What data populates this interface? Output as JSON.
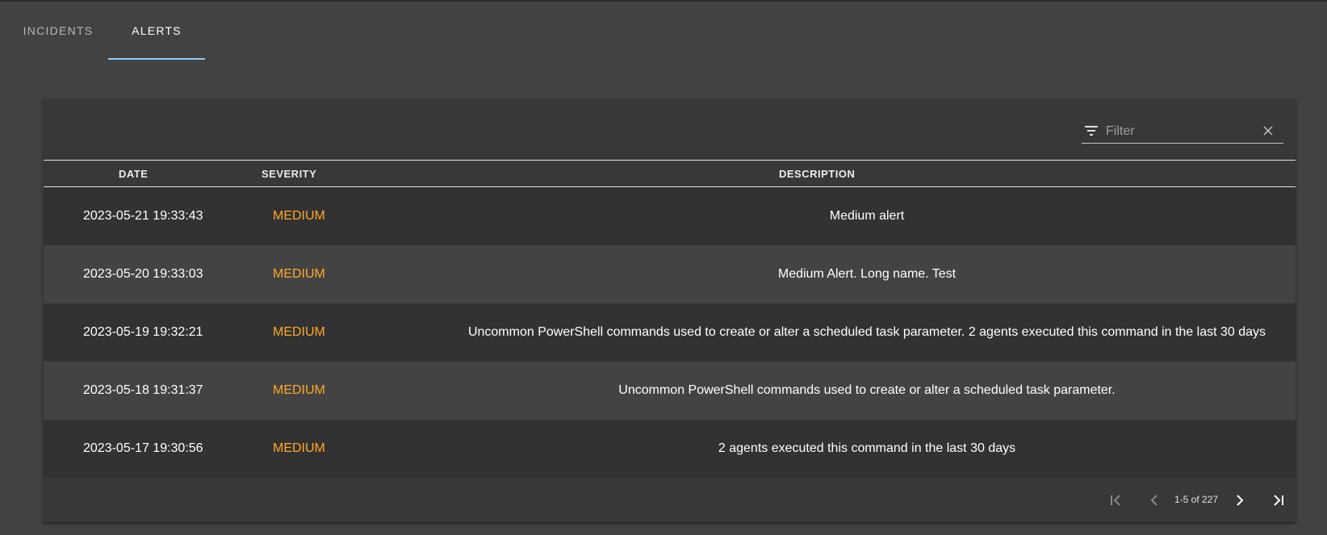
{
  "tabs": [
    {
      "label": "INCIDENTS",
      "active": false
    },
    {
      "label": "ALERTS",
      "active": true
    }
  ],
  "filter": {
    "placeholder": "Filter",
    "value": "",
    "icon": "filter-list-icon",
    "clear_icon": "close-icon"
  },
  "table": {
    "columns": [
      "DATE",
      "SEVERITY",
      "DESCRIPTION"
    ],
    "rows": [
      {
        "date": "2023-05-21 19:33:43",
        "severity": "MEDIUM",
        "description": "Medium alert"
      },
      {
        "date": "2023-05-20 19:33:03",
        "severity": "MEDIUM",
        "description": "Medium Alert. Long name. Test"
      },
      {
        "date": "2023-05-19 19:32:21",
        "severity": "MEDIUM",
        "description": "Uncommon PowerShell commands used to create or alter a scheduled task parameter. 2 agents executed this command in the last 30 days"
      },
      {
        "date": "2023-05-18 19:31:37",
        "severity": "MEDIUM",
        "description": "Uncommon PowerShell commands used to create or alter a scheduled task parameter."
      },
      {
        "date": "2023-05-17 19:30:56",
        "severity": "MEDIUM",
        "description": "2 agents executed this command in the last 30 days"
      }
    ]
  },
  "pagination": {
    "range_text": "1-5 of 227",
    "first_icon": "first-page-icon",
    "prev_icon": "chevron-left-icon",
    "next_icon": "chevron-right-icon",
    "last_icon": "last-page-icon"
  },
  "colors": {
    "background": "#424242",
    "card": "#383838",
    "row_dark": "#323232",
    "row_light": "#434343",
    "severity_medium": "#ffa726",
    "tab_indicator": "#90caf9"
  }
}
